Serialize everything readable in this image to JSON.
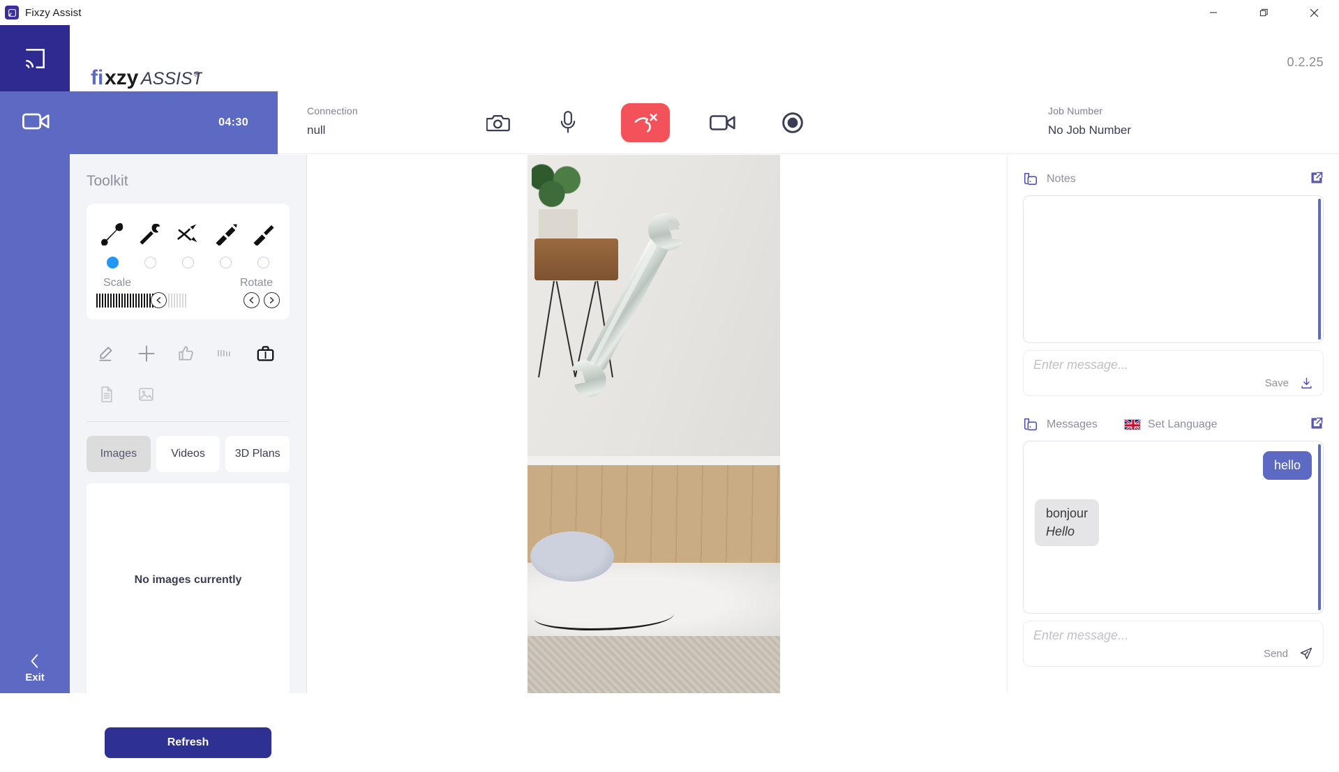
{
  "window": {
    "title": "Fixzy Assist",
    "app_icon": "cast-screen-icon",
    "controls": [
      {
        "name": "minimize",
        "glyph": "—"
      },
      {
        "name": "maximize",
        "glyph": "❐"
      },
      {
        "name": "close",
        "glyph": "✕"
      }
    ]
  },
  "brand": {
    "logo_primary": "fixzy",
    "logo_secondary": "ASSIST",
    "logo_mark": "®",
    "version": "0.2.25",
    "square_icon": "cast-screen-icon"
  },
  "actionbar": {
    "timer": "04:30",
    "video_icon": "video-camera-icon",
    "connection_label": "Connection",
    "connection_value": "null",
    "job_label": "Job Number",
    "job_value": "No Job Number",
    "buttons": [
      {
        "name": "camera-icon",
        "label": "Camera"
      },
      {
        "name": "microphone-icon",
        "label": "Microphone"
      },
      {
        "name": "hangup-icon",
        "label": "End Call"
      },
      {
        "name": "video-camera-icon",
        "label": "Video"
      },
      {
        "name": "record-icon",
        "label": "Record"
      }
    ]
  },
  "rail": {
    "exit_label": "Exit",
    "exit_icon": "chevron-left-icon"
  },
  "toolkit": {
    "title": "Toolkit",
    "tools": [
      {
        "name": "wrench-open-icon",
        "selected": true
      },
      {
        "name": "wrench-adjustable-icon",
        "selected": false
      },
      {
        "name": "pliers-icon",
        "selected": false
      },
      {
        "name": "screwdriver-flat-icon",
        "selected": false
      },
      {
        "name": "screwdriver-phillips-icon",
        "selected": false
      }
    ],
    "scale_label": "Scale",
    "rotate_label": "Rotate",
    "actions_row1": [
      "pen-underline-icon",
      "plus-icon",
      "thumbs-up-icon",
      "measure-icon",
      "briefcase-icon"
    ],
    "actions_row2": [
      "document-icon",
      "image-icon"
    ],
    "tabs": [
      {
        "label": "Images",
        "active": true
      },
      {
        "label": "Videos",
        "active": false
      },
      {
        "label": "3D Plans",
        "active": false
      }
    ],
    "empty_state": "No images currently",
    "refresh_label": "Refresh"
  },
  "notes": {
    "title": "Notes",
    "icon": "notes-icon",
    "popout_icon": "external-link-icon",
    "input_placeholder": "Enter message...",
    "input_value": "",
    "save_label": "Save",
    "save_icon": "download-icon"
  },
  "messages": {
    "title": "Messages",
    "icon": "messages-icon",
    "language_label": "Set Language",
    "language_flag": "uk-flag-icon",
    "popout_icon": "external-link-icon",
    "bubbles": [
      {
        "side": "outgoing",
        "text": "hello"
      },
      {
        "side": "incoming",
        "text": "bonjour",
        "translation": "Hello"
      }
    ],
    "input_placeholder": "Enter message...",
    "input_value": "",
    "send_label": "Send",
    "send_icon": "send-icon"
  },
  "colors": {
    "brand_dark": "#2e2a8f",
    "brand_mid": "#5c6ac4",
    "danger": "#f4525a",
    "accent_blue": "#2196f3"
  },
  "video": {
    "alt": "Live video feed of a room with an AR wrench overlay"
  }
}
